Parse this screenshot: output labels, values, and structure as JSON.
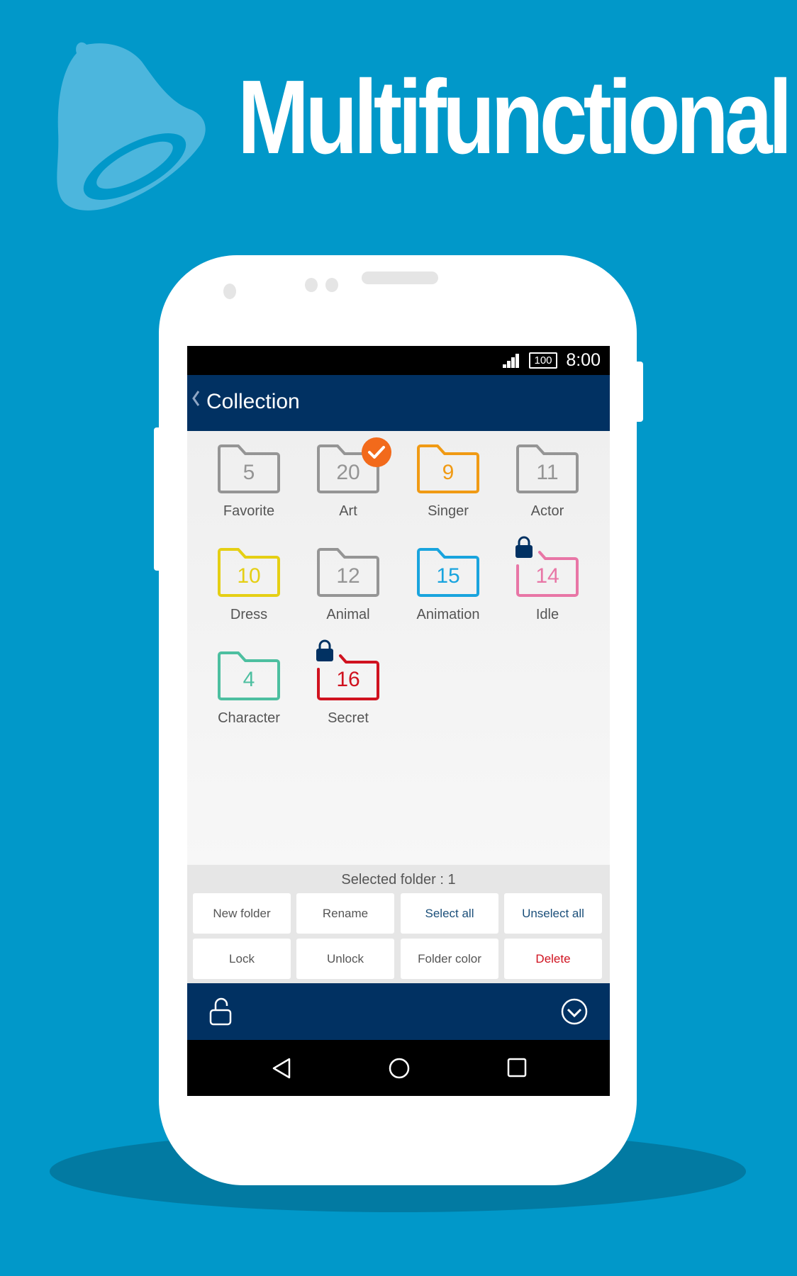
{
  "promo": {
    "headline": "Multifunctional",
    "icon": "bell-icon"
  },
  "status_bar": {
    "signal_icon": "signal-icon",
    "battery_level": "100",
    "time": "8:00"
  },
  "app_bar": {
    "back_icon": "chevron-left-icon",
    "title": "Collection"
  },
  "folders": [
    {
      "label": "Favorite",
      "count": "5",
      "color": "#959595",
      "selected": false,
      "locked": false
    },
    {
      "label": "Art",
      "count": "20",
      "color": "#959595",
      "selected": true,
      "locked": false
    },
    {
      "label": "Singer",
      "count": "9",
      "color": "#f09a14",
      "selected": false,
      "locked": false
    },
    {
      "label": "Actor",
      "count": "11",
      "color": "#959595",
      "selected": false,
      "locked": false
    },
    {
      "label": "Dress",
      "count": "10",
      "color": "#e5cf14",
      "selected": false,
      "locked": false
    },
    {
      "label": "Animal",
      "count": "12",
      "color": "#959595",
      "selected": false,
      "locked": false
    },
    {
      "label": "Animation",
      "count": "15",
      "color": "#19a4de",
      "selected": false,
      "locked": false
    },
    {
      "label": "Idle",
      "count": "14",
      "color": "#e876a6",
      "selected": false,
      "locked": true
    },
    {
      "label": "Character",
      "count": "4",
      "color": "#4dbfa0",
      "selected": false,
      "locked": false
    },
    {
      "label": "Secret",
      "count": "16",
      "color": "#d0121f",
      "selected": false,
      "locked": true
    }
  ],
  "selection": {
    "text": "Selected folder : 1"
  },
  "actions": [
    {
      "label": "New folder",
      "color": "#555555"
    },
    {
      "label": "Rename",
      "color": "#555555"
    },
    {
      "label": "Select all",
      "color": "#1b4f7a"
    },
    {
      "label": "Unselect all",
      "color": "#1b4f7a"
    },
    {
      "label": "Lock",
      "color": "#555555"
    },
    {
      "label": "Unlock",
      "color": "#555555"
    },
    {
      "label": "Folder color",
      "color": "#555555"
    },
    {
      "label": "Delete",
      "color": "#d0121f"
    }
  ],
  "bottom_bar": {
    "left_icon": "unlock-icon",
    "right_icon": "check-circle-icon"
  },
  "nav_bar": {
    "back": "back-triangle-icon",
    "home": "home-circle-icon",
    "recents": "recents-square-icon"
  },
  "colors": {
    "background": "#0198c9",
    "app_bar": "#013162",
    "selected_badge": "#f26a1b",
    "lock": "#013162"
  }
}
